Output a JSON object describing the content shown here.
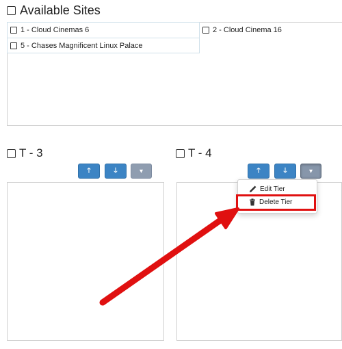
{
  "available_sites": {
    "title": "Available Sites",
    "sites": [
      {
        "label": "1 - Cloud Cinemas 6"
      },
      {
        "label": "2 - Cloud Cinema 16"
      },
      {
        "label": "5 - Chases Magnificent Linux Palace"
      }
    ]
  },
  "tiers": [
    {
      "title": "T - 3"
    },
    {
      "title": "T - 4"
    }
  ],
  "buttons": {
    "up_glyph": "🡑",
    "down_glyph": "🡓",
    "caret_glyph": "▾"
  },
  "dropdown_menu": {
    "items": [
      {
        "label": "Edit Tier",
        "icon": "pencil-icon"
      },
      {
        "label": "Delete Tier",
        "icon": "trash-icon"
      }
    ]
  },
  "colors": {
    "primary_button": "#3c84c4",
    "secondary_button": "#8f9db0",
    "highlight": "#e01010",
    "arrow": "#e01010"
  }
}
